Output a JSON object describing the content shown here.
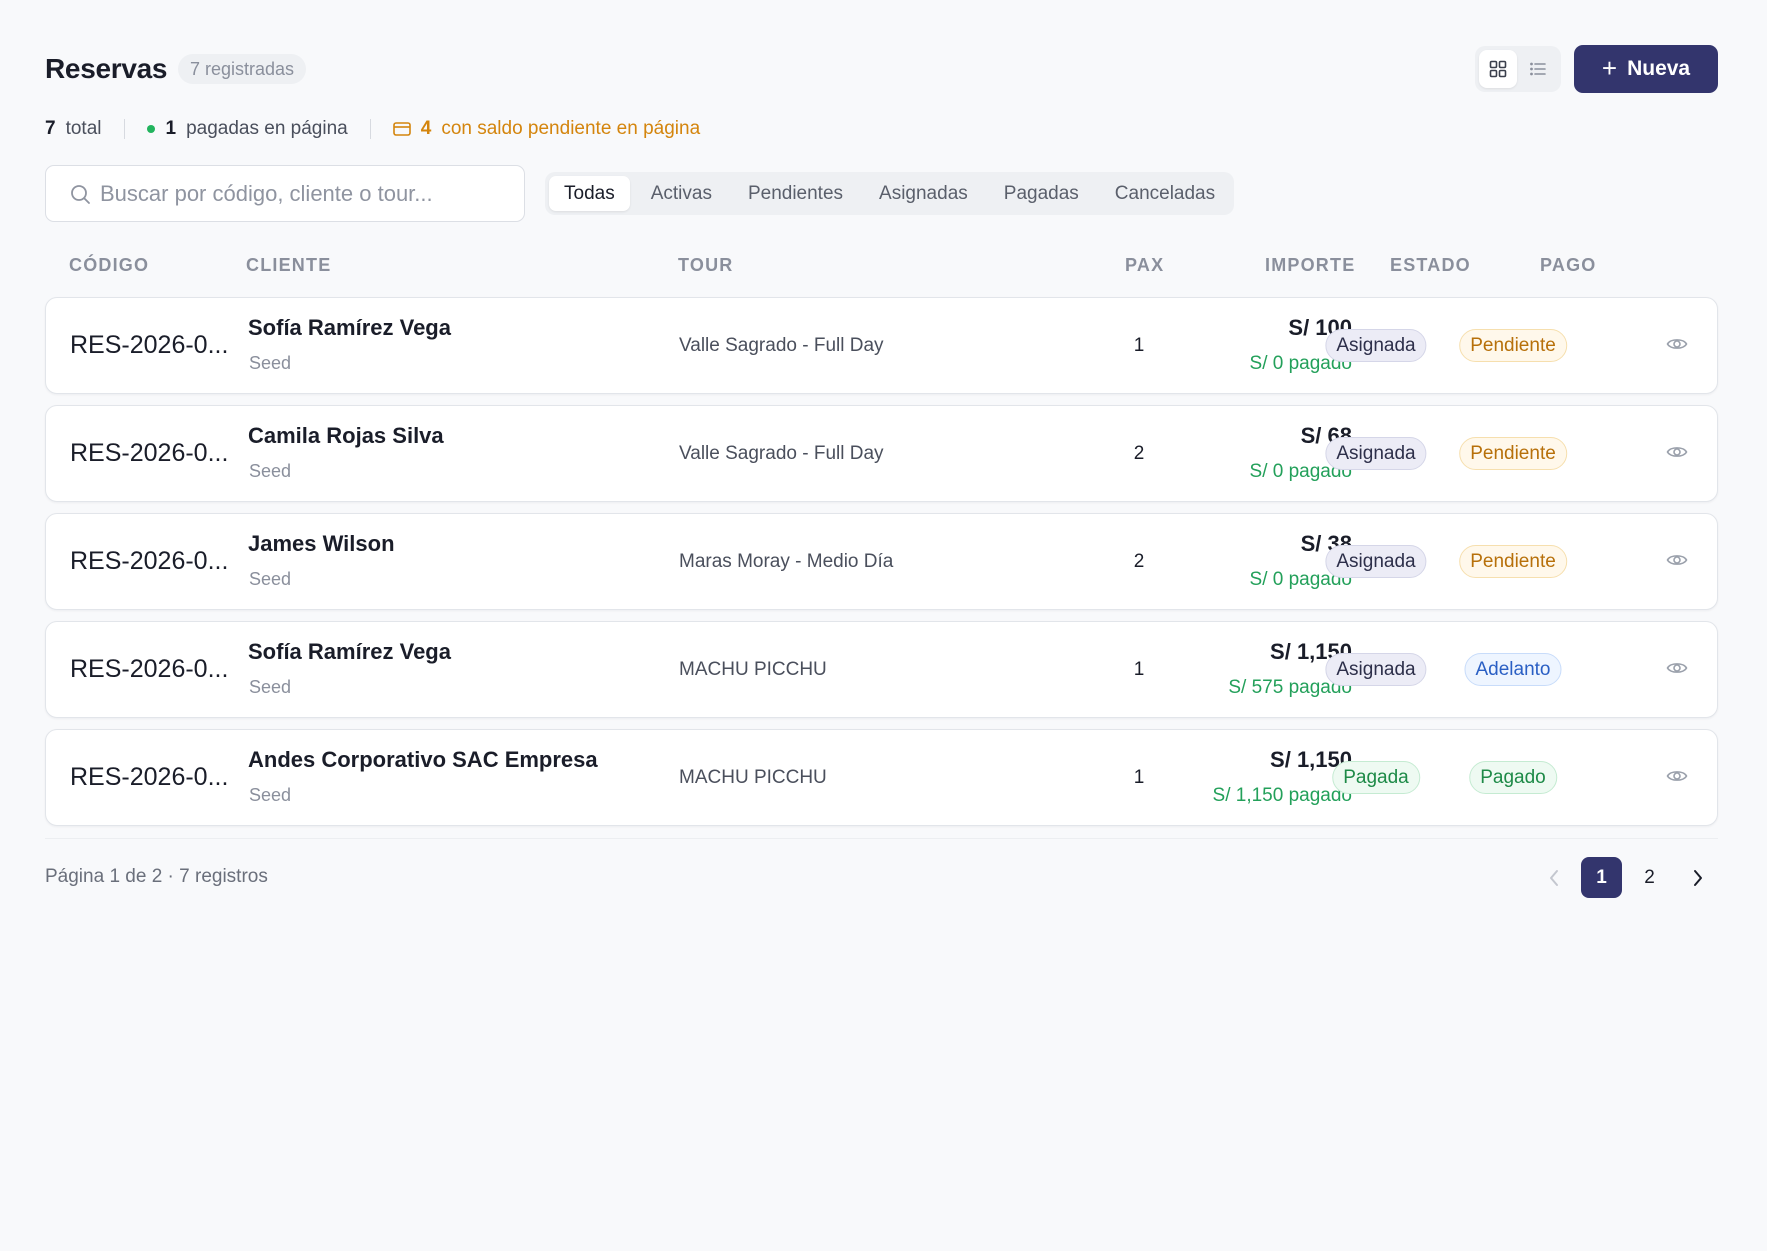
{
  "header": {
    "title": "Reservas",
    "count_badge": "7 registradas",
    "new_button": "Nueva",
    "plus_symbol": "+"
  },
  "stats": {
    "total_value": "7",
    "total_label": "total",
    "paid_value": "1",
    "paid_label": "pagadas en página",
    "pending_value": "4",
    "pending_label": "con saldo pendiente en página"
  },
  "search": {
    "placeholder": "Buscar por código, cliente o tour..."
  },
  "filters": [
    {
      "label": "Todas",
      "active": true
    },
    {
      "label": "Activas"
    },
    {
      "label": "Pendientes"
    },
    {
      "label": "Asignadas"
    },
    {
      "label": "Pagadas"
    },
    {
      "label": "Canceladas"
    }
  ],
  "columns": {
    "code": "CÓDIGO",
    "client": "CLIENTE",
    "tour": "TOUR",
    "pax": "PAX",
    "amount": "IMPORTE",
    "status": "ESTADO",
    "payment": "PAGO"
  },
  "rows": [
    {
      "code": "RES-2026-0...",
      "client": "Sofía Ramírez Vega",
      "source": "Seed",
      "tour": "Valle Sagrado - Full Day",
      "pax": "1",
      "amount": "S/ 100",
      "paid": "S/ 0 pagado",
      "status": "Asignada",
      "payment": "Pendiente"
    },
    {
      "code": "RES-2026-0...",
      "client": "Camila Rojas Silva",
      "source": "Seed",
      "tour": "Valle Sagrado - Full Day",
      "pax": "2",
      "amount": "S/ 68",
      "paid": "S/ 0 pagado",
      "status": "Asignada",
      "payment": "Pendiente"
    },
    {
      "code": "RES-2026-0...",
      "client": "James Wilson",
      "source": "Seed",
      "tour": "Maras Moray - Medio Día",
      "pax": "2",
      "amount": "S/ 38",
      "paid": "S/ 0 pagado",
      "status": "Asignada",
      "payment": "Pendiente"
    },
    {
      "code": "RES-2026-0...",
      "client": "Sofía Ramírez Vega",
      "source": "Seed",
      "tour": "MACHU PICCHU",
      "pax": "1",
      "amount": "S/ 1,150",
      "paid": "S/ 575 pagado",
      "status": "Asignada",
      "payment": "Adelanto"
    },
    {
      "code": "RES-2026-0...",
      "client": "Andes Corporativo SAC Empresa",
      "source": "Seed",
      "tour": "MACHU PICCHU",
      "pax": "1",
      "amount": "S/ 1,150",
      "paid": "S/ 1,150 pagado",
      "status": "Pagada",
      "payment": "Pagado"
    }
  ],
  "pagination": {
    "info": "Página 1 de 2 · 7 registros",
    "pages": [
      "1",
      "2"
    ],
    "current": "1"
  },
  "colors": {
    "accent": "#33356d",
    "paid_green": "#23a05a",
    "pending_orange": "#d4850d"
  }
}
